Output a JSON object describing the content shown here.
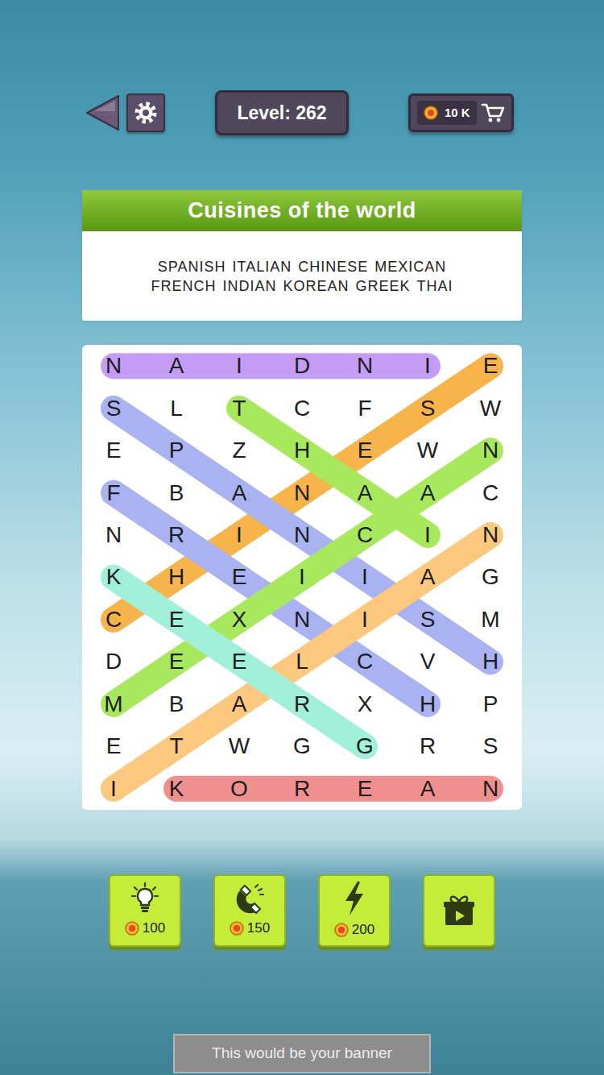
{
  "top_bar": {
    "level": "Level: 262",
    "coins": "10 K"
  },
  "puzzle": {
    "title": "Cuisines of the world",
    "word_lines": [
      [
        "SPANISH",
        "ITALIAN",
        "CHINESE",
        "MEXICAN"
      ],
      [
        "FRENCH",
        "INDIAN",
        "KOREAN",
        "GREEK",
        "THAI"
      ]
    ]
  },
  "grid": {
    "rows": [
      [
        "N",
        "A",
        "I",
        "D",
        "N",
        "I",
        "E"
      ],
      [
        "S",
        "L",
        "T",
        "C",
        "F",
        "S",
        "W"
      ],
      [
        "E",
        "P",
        "Z",
        "H",
        "E",
        "W",
        "N"
      ],
      [
        "F",
        "B",
        "A",
        "N",
        "A",
        "A",
        "C"
      ],
      [
        "N",
        "R",
        "I",
        "N",
        "C",
        "I",
        "N"
      ],
      [
        "K",
        "H",
        "E",
        "I",
        "I",
        "A",
        "G"
      ],
      [
        "C",
        "E",
        "X",
        "N",
        "I",
        "S",
        "M"
      ],
      [
        "D",
        "E",
        "E",
        "L",
        "C",
        "V",
        "H"
      ],
      [
        "M",
        "B",
        "A",
        "R",
        "X",
        "H",
        "P"
      ],
      [
        "E",
        "T",
        "W",
        "G",
        "G",
        "R",
        "S"
      ],
      [
        "I",
        "K",
        "O",
        "R",
        "E",
        "A",
        "N"
      ]
    ]
  },
  "found": [
    {
      "color": "#c49cf5",
      "start": [
        0,
        5
      ],
      "end": [
        0,
        0
      ]
    },
    {
      "color": "#f6b44a",
      "start": [
        0,
        6
      ],
      "end": [
        6,
        0
      ]
    },
    {
      "color": "#a9b3f2",
      "start": [
        1,
        0
      ],
      "end": [
        7,
        6
      ]
    },
    {
      "color": "#a9b3f2",
      "start": [
        3,
        0
      ],
      "end": [
        8,
        5
      ]
    },
    {
      "color": "#fcc87e",
      "start": [
        4,
        6
      ],
      "end": [
        10,
        0
      ]
    },
    {
      "color": "#a8e85c",
      "start": [
        1,
        2
      ],
      "end": [
        4,
        5
      ]
    },
    {
      "color": "#a8e85c",
      "start": [
        2,
        6
      ],
      "end": [
        8,
        0
      ]
    },
    {
      "color": "#a0f0da",
      "start": [
        5,
        0
      ],
      "end": [
        9,
        4
      ]
    },
    {
      "color": "#f08f8f",
      "start": [
        10,
        1
      ],
      "end": [
        10,
        6
      ]
    }
  ],
  "tools": [
    {
      "kind": "hint",
      "cost": "100"
    },
    {
      "kind": "magnet",
      "cost": "150"
    },
    {
      "kind": "lightning",
      "cost": "200"
    },
    {
      "kind": "video"
    }
  ],
  "banner": "This would be your banner"
}
